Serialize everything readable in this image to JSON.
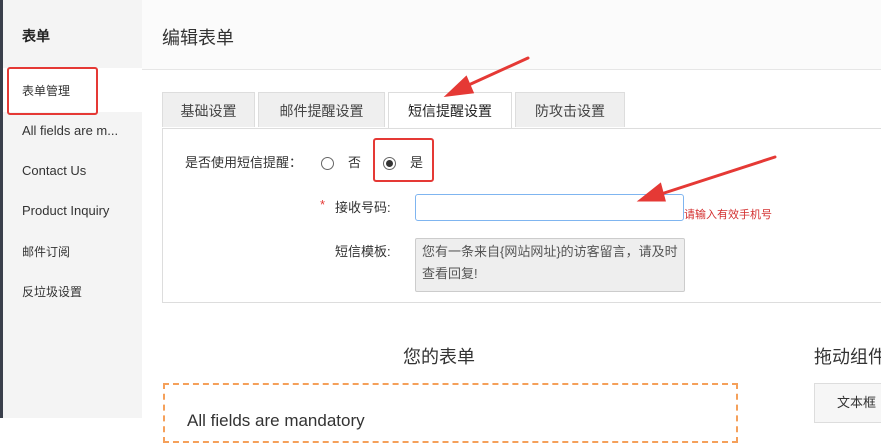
{
  "sidebar": {
    "title": "表单",
    "items": [
      {
        "label": "表单管理"
      },
      {
        "label": "All fields are m..."
      },
      {
        "label": "Contact Us"
      },
      {
        "label": "Product Inquiry"
      },
      {
        "label": "邮件订阅"
      },
      {
        "label": "反垃圾设置"
      }
    ]
  },
  "header": {
    "title": "编辑表单"
  },
  "tabs": [
    {
      "label": "基础设置"
    },
    {
      "label": "邮件提醒设置"
    },
    {
      "label": "短信提醒设置"
    },
    {
      "label": "防攻击设置"
    }
  ],
  "form": {
    "sms_toggle_label": "是否使用短信提醒：",
    "option_no": "否",
    "option_yes": "是",
    "selected": "是",
    "phone_label": "接收号码:",
    "phone_required_mark": "*",
    "phone_value": "",
    "phone_hint": "请输入有效手机号",
    "template_label": "短信模板:",
    "template_text": "您有一条来自{网站网址}的访客留言，请及时查看回复!"
  },
  "builder": {
    "your_form_title": "您的表单",
    "drag_components_title": "拖动组件",
    "form_preview_text": "All fields are mandatory",
    "widget_label": "文本框"
  },
  "colors": {
    "annotation_red": "#e53935",
    "hint_red": "#d32f2f",
    "input_border_focus": "#7fb5f0",
    "dashed_orange": "#f5a05a"
  }
}
